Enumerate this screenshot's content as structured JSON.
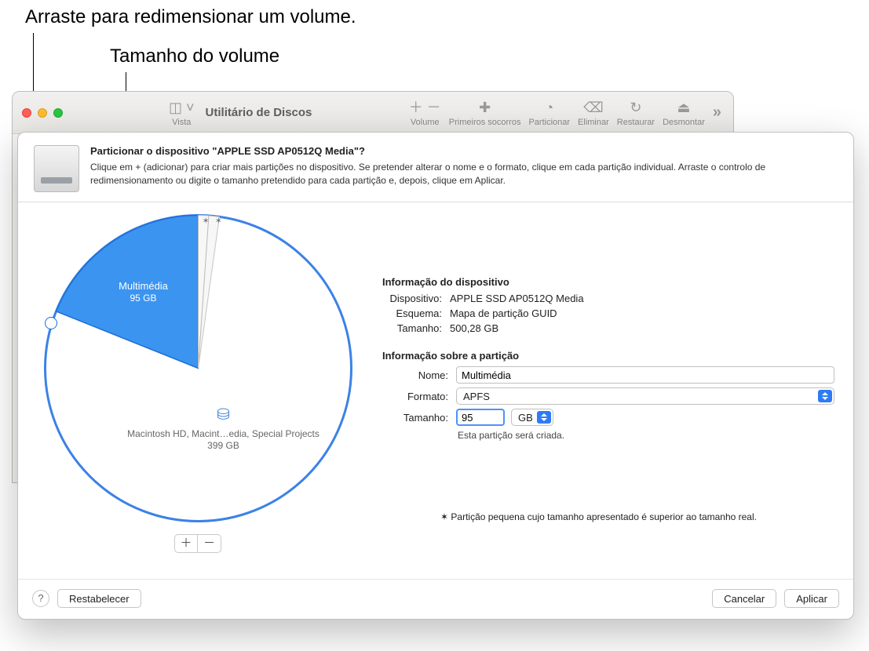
{
  "callouts": {
    "drag": "Arraste para redimensionar um volume.",
    "size": "Tamanho do volume"
  },
  "toolbar": {
    "view": "Vista",
    "app_title": "Utilitário de Discos",
    "volume": "Volume",
    "first_aid": "Primeiros socorros",
    "partition": "Particionar",
    "erase": "Eliminar",
    "restore": "Restaurar",
    "unmount": "Desmontar"
  },
  "dialog": {
    "title": "Particionar o dispositivo \"APPLE SSD AP0512Q Media\"?",
    "description": "Clique em + (adicionar) para criar mais partições no dispositivo. Se pretender alterar o nome e o formato, clique em cada partição individual. Arraste o controlo de redimensionamento ou digite o tamanho pretendido para cada partição e, depois, clique em Aplicar."
  },
  "pie": {
    "selected": {
      "name": "Multimédia",
      "size": "95 GB"
    },
    "rest": {
      "name": "Macintosh HD, Macint…edia, Special Projects",
      "size": "399 GB"
    },
    "stars": "✶  ✶"
  },
  "device_info": {
    "heading": "Informação do dispositivo",
    "device_label": "Dispositivo:",
    "device_value": "APPLE SSD AP0512Q Media",
    "scheme_label": "Esquema:",
    "scheme_value": "Mapa de partição GUID",
    "size_label": "Tamanho:",
    "size_value": "500,28 GB"
  },
  "partition_info": {
    "heading": "Informação sobre a partição",
    "name_label": "Nome:",
    "name_value": "Multimédia",
    "format_label": "Formato:",
    "format_value": "APFS",
    "size_label": "Tamanho:",
    "size_value": "95",
    "size_unit": "GB",
    "will_create": "Esta partição será criada."
  },
  "footnote": "✶ Partição pequena cujo tamanho apresentado é superior ao tamanho real.",
  "buttons": {
    "reset": "Restabelecer",
    "cancel": "Cancelar",
    "apply": "Aplicar"
  },
  "chart_data": {
    "type": "pie",
    "title": "",
    "slices": [
      {
        "name": "Multimédia",
        "value_gb": 95,
        "selected": true,
        "color": "#3b94f0"
      },
      {
        "name": "Macintosh HD, Macint…edia, Special Projects",
        "value_gb": 399,
        "selected": false,
        "color": "#ffffff"
      }
    ],
    "small_partitions_indicator": 2,
    "total_gb": 500.28
  }
}
